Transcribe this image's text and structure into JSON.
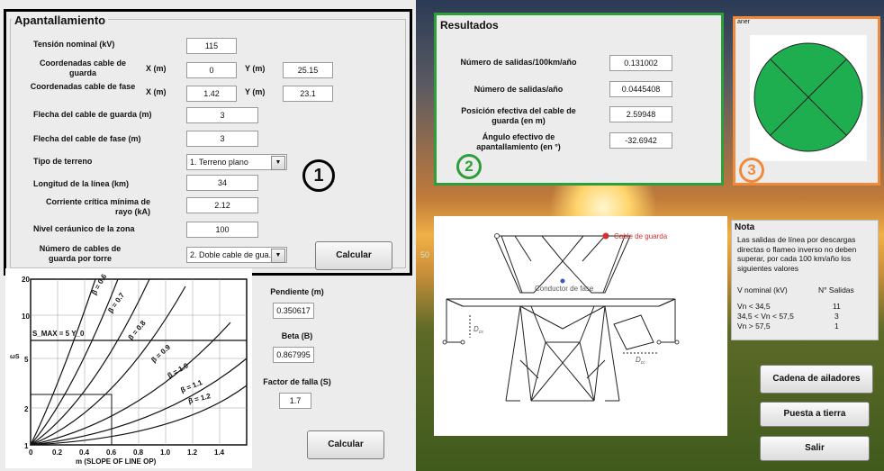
{
  "apantallamiento": {
    "title": "Apantallamiento",
    "tension_label": "Tensión nominal (kV)",
    "tension_value": "115",
    "guarda_label": "Coordenadas cable de guarda",
    "x_label": "X (m)",
    "y_label": "Y (m)",
    "guarda_x": "0",
    "guarda_y": "25.15",
    "fase_label": "Coordenadas cable de fase",
    "fase_x": "1.42",
    "fase_y": "23.1",
    "flecha_guarda_label": "Flecha del cable de guarda (m)",
    "flecha_guarda_value": "3",
    "flecha_fase_label": "Flecha del cable de fase (m)",
    "flecha_fase_value": "3",
    "terreno_label": "Tipo de terreno",
    "terreno_value": "1. Terreno plano",
    "longitud_label": "Longitud de la línea (km)",
    "longitud_value": "34",
    "corriente_label": "Corriente crítica mínima de rayo (kA)",
    "corriente_value": "2.12",
    "nivel_label": "Nivel ceráunico de la zona",
    "nivel_value": "100",
    "cables_label": "Número de cables de guarda por torre",
    "cables_value": "2. Doble cable de gua...",
    "calcular_label": "Calcular",
    "badge": "1"
  },
  "resultados": {
    "title": "Resultados",
    "rows": [
      {
        "label": "Número de salidas/100km/año",
        "value": "0.131002"
      },
      {
        "label": "Número de salidas/año",
        "value": "0.0445408"
      },
      {
        "label": "Posición efectiva del cable de guarda (en m)",
        "value": "2.59948"
      },
      {
        "label": "Ángulo efectivo de apantallamiento (en °)",
        "value": "-32.6942"
      }
    ],
    "badge": "2"
  },
  "indicator": {
    "corner_text": "aner",
    "badge": "3",
    "color": "#1fae4f"
  },
  "nota": {
    "title": "Nota",
    "text": "Las salidas de línea por descargas directas o flameo inverso no deben superar, por cada 100 km/año los siguientes valores",
    "col1": "V nominal (kV)",
    "col2": "N° Salidas",
    "rows": [
      {
        "v": "Vn < 34,5",
        "n": "11"
      },
      {
        "v": "34,5 < Vn < 57,5",
        "n": "3"
      },
      {
        "v": "Vn > 57,5",
        "n": "1"
      }
    ]
  },
  "tower": {
    "cable_guarda": "Cable de guarda",
    "conductor_fase": "Conductor de fase",
    "dcs": "D",
    "dcs_sub": "cs",
    "dcc_sub": "cc",
    "axis_tick": "50"
  },
  "graph": {
    "y_ticks": [
      "20",
      "10",
      "5",
      "2",
      "1"
    ],
    "x_ticks": [
      "0",
      "0.2",
      "0.4",
      "0.6",
      "0.8",
      "1.0",
      "1.2",
      "1.4"
    ],
    "xlabel": "m (SLOPE OF LINE OP)",
    "ylabel": "ωS",
    "curves": [
      "β = 0.6",
      "β = 0.7",
      "β = 0.8",
      "β = 0.9",
      "β = 1.0",
      "β = 1.1",
      "β = 1.2"
    ],
    "smax": "S_MAX = 5 Y_0"
  },
  "side": {
    "pendiente_label": "Pendiente (m)",
    "pendiente_value": "0.350617",
    "beta_label": "Beta (B)",
    "beta_value": "0.867995",
    "falla_label": "Factor de falla (S)",
    "falla_value": "1.7",
    "calcular_label": "Calcular"
  },
  "buttons": {
    "cadena": "Cadena de ailadores",
    "puesta": "Puesta a tierra",
    "salir": "Salir"
  }
}
